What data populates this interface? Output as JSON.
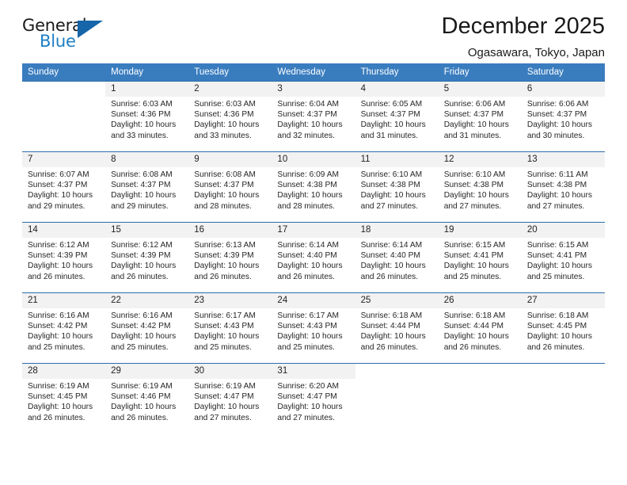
{
  "brand": {
    "name_top": "General",
    "name_bottom": "Blue",
    "accent_color": "#1f7fc4",
    "triangle_color": "#1565a8"
  },
  "header": {
    "title": "December 2025",
    "subtitle": "Ogasawara, Tokyo, Japan",
    "header_bg": "#3a7dbf",
    "header_text_color": "#ffffff"
  },
  "weekday_headers": [
    "Sunday",
    "Monday",
    "Tuesday",
    "Wednesday",
    "Thursday",
    "Friday",
    "Saturday"
  ],
  "weeks": [
    [
      {
        "day": "",
        "sunrise": "",
        "sunset": "",
        "daylight_line1": "",
        "daylight_line2": ""
      },
      {
        "day": "1",
        "sunrise": "Sunrise: 6:03 AM",
        "sunset": "Sunset: 4:36 PM",
        "daylight_line1": "Daylight: 10 hours",
        "daylight_line2": "and 33 minutes."
      },
      {
        "day": "2",
        "sunrise": "Sunrise: 6:03 AM",
        "sunset": "Sunset: 4:36 PM",
        "daylight_line1": "Daylight: 10 hours",
        "daylight_line2": "and 33 minutes."
      },
      {
        "day": "3",
        "sunrise": "Sunrise: 6:04 AM",
        "sunset": "Sunset: 4:37 PM",
        "daylight_line1": "Daylight: 10 hours",
        "daylight_line2": "and 32 minutes."
      },
      {
        "day": "4",
        "sunrise": "Sunrise: 6:05 AM",
        "sunset": "Sunset: 4:37 PM",
        "daylight_line1": "Daylight: 10 hours",
        "daylight_line2": "and 31 minutes."
      },
      {
        "day": "5",
        "sunrise": "Sunrise: 6:06 AM",
        "sunset": "Sunset: 4:37 PM",
        "daylight_line1": "Daylight: 10 hours",
        "daylight_line2": "and 31 minutes."
      },
      {
        "day": "6",
        "sunrise": "Sunrise: 6:06 AM",
        "sunset": "Sunset: 4:37 PM",
        "daylight_line1": "Daylight: 10 hours",
        "daylight_line2": "and 30 minutes."
      }
    ],
    [
      {
        "day": "7",
        "sunrise": "Sunrise: 6:07 AM",
        "sunset": "Sunset: 4:37 PM",
        "daylight_line1": "Daylight: 10 hours",
        "daylight_line2": "and 29 minutes."
      },
      {
        "day": "8",
        "sunrise": "Sunrise: 6:08 AM",
        "sunset": "Sunset: 4:37 PM",
        "daylight_line1": "Daylight: 10 hours",
        "daylight_line2": "and 29 minutes."
      },
      {
        "day": "9",
        "sunrise": "Sunrise: 6:08 AM",
        "sunset": "Sunset: 4:37 PM",
        "daylight_line1": "Daylight: 10 hours",
        "daylight_line2": "and 28 minutes."
      },
      {
        "day": "10",
        "sunrise": "Sunrise: 6:09 AM",
        "sunset": "Sunset: 4:38 PM",
        "daylight_line1": "Daylight: 10 hours",
        "daylight_line2": "and 28 minutes."
      },
      {
        "day": "11",
        "sunrise": "Sunrise: 6:10 AM",
        "sunset": "Sunset: 4:38 PM",
        "daylight_line1": "Daylight: 10 hours",
        "daylight_line2": "and 27 minutes."
      },
      {
        "day": "12",
        "sunrise": "Sunrise: 6:10 AM",
        "sunset": "Sunset: 4:38 PM",
        "daylight_line1": "Daylight: 10 hours",
        "daylight_line2": "and 27 minutes."
      },
      {
        "day": "13",
        "sunrise": "Sunrise: 6:11 AM",
        "sunset": "Sunset: 4:38 PM",
        "daylight_line1": "Daylight: 10 hours",
        "daylight_line2": "and 27 minutes."
      }
    ],
    [
      {
        "day": "14",
        "sunrise": "Sunrise: 6:12 AM",
        "sunset": "Sunset: 4:39 PM",
        "daylight_line1": "Daylight: 10 hours",
        "daylight_line2": "and 26 minutes."
      },
      {
        "day": "15",
        "sunrise": "Sunrise: 6:12 AM",
        "sunset": "Sunset: 4:39 PM",
        "daylight_line1": "Daylight: 10 hours",
        "daylight_line2": "and 26 minutes."
      },
      {
        "day": "16",
        "sunrise": "Sunrise: 6:13 AM",
        "sunset": "Sunset: 4:39 PM",
        "daylight_line1": "Daylight: 10 hours",
        "daylight_line2": "and 26 minutes."
      },
      {
        "day": "17",
        "sunrise": "Sunrise: 6:14 AM",
        "sunset": "Sunset: 4:40 PM",
        "daylight_line1": "Daylight: 10 hours",
        "daylight_line2": "and 26 minutes."
      },
      {
        "day": "18",
        "sunrise": "Sunrise: 6:14 AM",
        "sunset": "Sunset: 4:40 PM",
        "daylight_line1": "Daylight: 10 hours",
        "daylight_line2": "and 26 minutes."
      },
      {
        "day": "19",
        "sunrise": "Sunrise: 6:15 AM",
        "sunset": "Sunset: 4:41 PM",
        "daylight_line1": "Daylight: 10 hours",
        "daylight_line2": "and 25 minutes."
      },
      {
        "day": "20",
        "sunrise": "Sunrise: 6:15 AM",
        "sunset": "Sunset: 4:41 PM",
        "daylight_line1": "Daylight: 10 hours",
        "daylight_line2": "and 25 minutes."
      }
    ],
    [
      {
        "day": "21",
        "sunrise": "Sunrise: 6:16 AM",
        "sunset": "Sunset: 4:42 PM",
        "daylight_line1": "Daylight: 10 hours",
        "daylight_line2": "and 25 minutes."
      },
      {
        "day": "22",
        "sunrise": "Sunrise: 6:16 AM",
        "sunset": "Sunset: 4:42 PM",
        "daylight_line1": "Daylight: 10 hours",
        "daylight_line2": "and 25 minutes."
      },
      {
        "day": "23",
        "sunrise": "Sunrise: 6:17 AM",
        "sunset": "Sunset: 4:43 PM",
        "daylight_line1": "Daylight: 10 hours",
        "daylight_line2": "and 25 minutes."
      },
      {
        "day": "24",
        "sunrise": "Sunrise: 6:17 AM",
        "sunset": "Sunset: 4:43 PM",
        "daylight_line1": "Daylight: 10 hours",
        "daylight_line2": "and 25 minutes."
      },
      {
        "day": "25",
        "sunrise": "Sunrise: 6:18 AM",
        "sunset": "Sunset: 4:44 PM",
        "daylight_line1": "Daylight: 10 hours",
        "daylight_line2": "and 26 minutes."
      },
      {
        "day": "26",
        "sunrise": "Sunrise: 6:18 AM",
        "sunset": "Sunset: 4:44 PM",
        "daylight_line1": "Daylight: 10 hours",
        "daylight_line2": "and 26 minutes."
      },
      {
        "day": "27",
        "sunrise": "Sunrise: 6:18 AM",
        "sunset": "Sunset: 4:45 PM",
        "daylight_line1": "Daylight: 10 hours",
        "daylight_line2": "and 26 minutes."
      }
    ],
    [
      {
        "day": "28",
        "sunrise": "Sunrise: 6:19 AM",
        "sunset": "Sunset: 4:45 PM",
        "daylight_line1": "Daylight: 10 hours",
        "daylight_line2": "and 26 minutes."
      },
      {
        "day": "29",
        "sunrise": "Sunrise: 6:19 AM",
        "sunset": "Sunset: 4:46 PM",
        "daylight_line1": "Daylight: 10 hours",
        "daylight_line2": "and 26 minutes."
      },
      {
        "day": "30",
        "sunrise": "Sunrise: 6:19 AM",
        "sunset": "Sunset: 4:47 PM",
        "daylight_line1": "Daylight: 10 hours",
        "daylight_line2": "and 27 minutes."
      },
      {
        "day": "31",
        "sunrise": "Sunrise: 6:20 AM",
        "sunset": "Sunset: 4:47 PM",
        "daylight_line1": "Daylight: 10 hours",
        "daylight_line2": "and 27 minutes."
      },
      {
        "day": "",
        "sunrise": "",
        "sunset": "",
        "daylight_line1": "",
        "daylight_line2": ""
      },
      {
        "day": "",
        "sunrise": "",
        "sunset": "",
        "daylight_line1": "",
        "daylight_line2": ""
      },
      {
        "day": "",
        "sunrise": "",
        "sunset": "",
        "daylight_line1": "",
        "daylight_line2": ""
      }
    ]
  ]
}
